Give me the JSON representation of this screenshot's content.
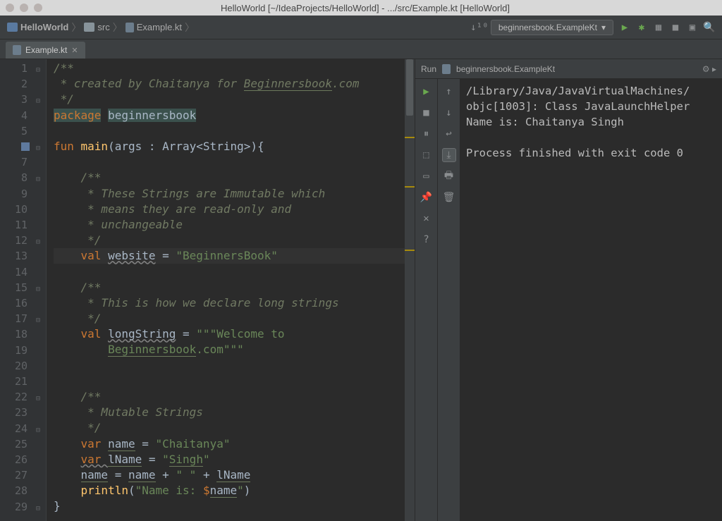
{
  "window": {
    "title": "HelloWorld [~/IdeaProjects/HelloWorld] - .../src/Example.kt [HelloWorld]"
  },
  "breadcrumbs": {
    "items": [
      {
        "label": "HelloWorld"
      },
      {
        "label": "src"
      },
      {
        "label": "Example.kt"
      }
    ]
  },
  "run_config": {
    "label": "beginnersbook.ExampleKt",
    "dd": "▾"
  },
  "tabs": {
    "active": {
      "label": "Example.kt"
    }
  },
  "code": {
    "lines": [
      {
        "n": 1,
        "segs": [
          {
            "t": "/**",
            "c": "c-comment"
          }
        ]
      },
      {
        "n": 2,
        "segs": [
          {
            "t": " * created by Chaitanya for ",
            "c": "c-comment"
          },
          {
            "t": "Beginnersbook",
            "c": "c-comment underline"
          },
          {
            "t": ".com",
            "c": "c-comment"
          }
        ]
      },
      {
        "n": 3,
        "segs": [
          {
            "t": " */",
            "c": "c-comment"
          }
        ]
      },
      {
        "n": 4,
        "segs": [
          {
            "t": "package",
            "c": "c-keyword c-pkg"
          },
          {
            "t": " ",
            "c": ""
          },
          {
            "t": "beginnersbook",
            "c": "c-pkg"
          }
        ]
      },
      {
        "n": 5,
        "segs": []
      },
      {
        "n": 6,
        "run": true,
        "segs": [
          {
            "t": "fun ",
            "c": "c-keyword"
          },
          {
            "t": "main",
            "c": "c-func"
          },
          {
            "t": "(args : Array<String>){",
            "c": ""
          }
        ]
      },
      {
        "n": 7,
        "segs": []
      },
      {
        "n": 8,
        "segs": [
          {
            "t": "    /**",
            "c": "c-comment"
          }
        ]
      },
      {
        "n": 9,
        "segs": [
          {
            "t": "     * These Strings are Immutable which",
            "c": "c-comment"
          }
        ]
      },
      {
        "n": 10,
        "segs": [
          {
            "t": "     * means they are read-only and",
            "c": "c-comment"
          }
        ]
      },
      {
        "n": 11,
        "segs": [
          {
            "t": "     * unchangeable",
            "c": "c-comment"
          }
        ]
      },
      {
        "n": 12,
        "segs": [
          {
            "t": "     */",
            "c": "c-comment"
          }
        ]
      },
      {
        "n": 13,
        "cur": true,
        "segs": [
          {
            "t": "    ",
            "c": ""
          },
          {
            "t": "val ",
            "c": "c-keyword"
          },
          {
            "t": "website",
            "c": "wavy"
          },
          {
            "t": " = ",
            "c": ""
          },
          {
            "t": "\"BeginnersBook\"",
            "c": "c-string"
          }
        ]
      },
      {
        "n": 14,
        "segs": []
      },
      {
        "n": 15,
        "segs": [
          {
            "t": "    /**",
            "c": "c-comment"
          }
        ]
      },
      {
        "n": 16,
        "segs": [
          {
            "t": "     * This is how we declare long strings",
            "c": "c-comment"
          }
        ]
      },
      {
        "n": 17,
        "segs": [
          {
            "t": "     */",
            "c": "c-comment"
          }
        ]
      },
      {
        "n": 18,
        "segs": [
          {
            "t": "    ",
            "c": ""
          },
          {
            "t": "val ",
            "c": "c-keyword"
          },
          {
            "t": "longString",
            "c": "wavy"
          },
          {
            "t": " = ",
            "c": ""
          },
          {
            "t": "\"\"\"Welcome to",
            "c": "c-string"
          }
        ]
      },
      {
        "n": 19,
        "segs": [
          {
            "t": "        ",
            "c": ""
          },
          {
            "t": "Beginnersbook",
            "c": "c-string underline"
          },
          {
            "t": ".com\"\"\"",
            "c": "c-string"
          }
        ]
      },
      {
        "n": 20,
        "segs": []
      },
      {
        "n": 21,
        "segs": []
      },
      {
        "n": 22,
        "segs": [
          {
            "t": "    /**",
            "c": "c-comment"
          }
        ]
      },
      {
        "n": 23,
        "segs": [
          {
            "t": "     * Mutable Strings",
            "c": "c-comment"
          }
        ]
      },
      {
        "n": 24,
        "segs": [
          {
            "t": "     */",
            "c": "c-comment"
          }
        ]
      },
      {
        "n": 25,
        "segs": [
          {
            "t": "    ",
            "c": ""
          },
          {
            "t": "var ",
            "c": "c-keyword"
          },
          {
            "t": "name",
            "c": "underline"
          },
          {
            "t": " = ",
            "c": ""
          },
          {
            "t": "\"Chaitanya\"",
            "c": "c-string"
          }
        ]
      },
      {
        "n": 26,
        "segs": [
          {
            "t": "    ",
            "c": ""
          },
          {
            "t": "var ",
            "c": "c-keyword wavy"
          },
          {
            "t": "lName",
            "c": "underline"
          },
          {
            "t": " = ",
            "c": ""
          },
          {
            "t": "\"",
            "c": "c-string"
          },
          {
            "t": "Singh",
            "c": "c-string underline"
          },
          {
            "t": "\"",
            "c": "c-string"
          }
        ]
      },
      {
        "n": 27,
        "segs": [
          {
            "t": "    ",
            "c": ""
          },
          {
            "t": "name",
            "c": "underline"
          },
          {
            "t": " = ",
            "c": ""
          },
          {
            "t": "name",
            "c": "underline"
          },
          {
            "t": " + ",
            "c": ""
          },
          {
            "t": "\" \"",
            "c": "c-string"
          },
          {
            "t": " + ",
            "c": ""
          },
          {
            "t": "lName",
            "c": "underline"
          }
        ]
      },
      {
        "n": 28,
        "segs": [
          {
            "t": "    ",
            "c": ""
          },
          {
            "t": "println",
            "c": "c-func"
          },
          {
            "t": "(",
            "c": ""
          },
          {
            "t": "\"Name is: ",
            "c": "c-string"
          },
          {
            "t": "$",
            "c": "c-keyword"
          },
          {
            "t": "name",
            "c": "underline"
          },
          {
            "t": "\"",
            "c": "c-string"
          },
          {
            "t": ")",
            "c": ""
          }
        ]
      },
      {
        "n": 29,
        "segs": [
          {
            "t": "}",
            "c": ""
          }
        ]
      }
    ]
  },
  "run_panel": {
    "title_prefix": "Run",
    "title": "beginnersbook.ExampleKt",
    "output": "/Library/Java/JavaVirtualMachines/\nobjc[1003]: Class JavaLaunchHelper\nName is: Chaitanya Singh\n\nProcess finished with exit code 0"
  }
}
